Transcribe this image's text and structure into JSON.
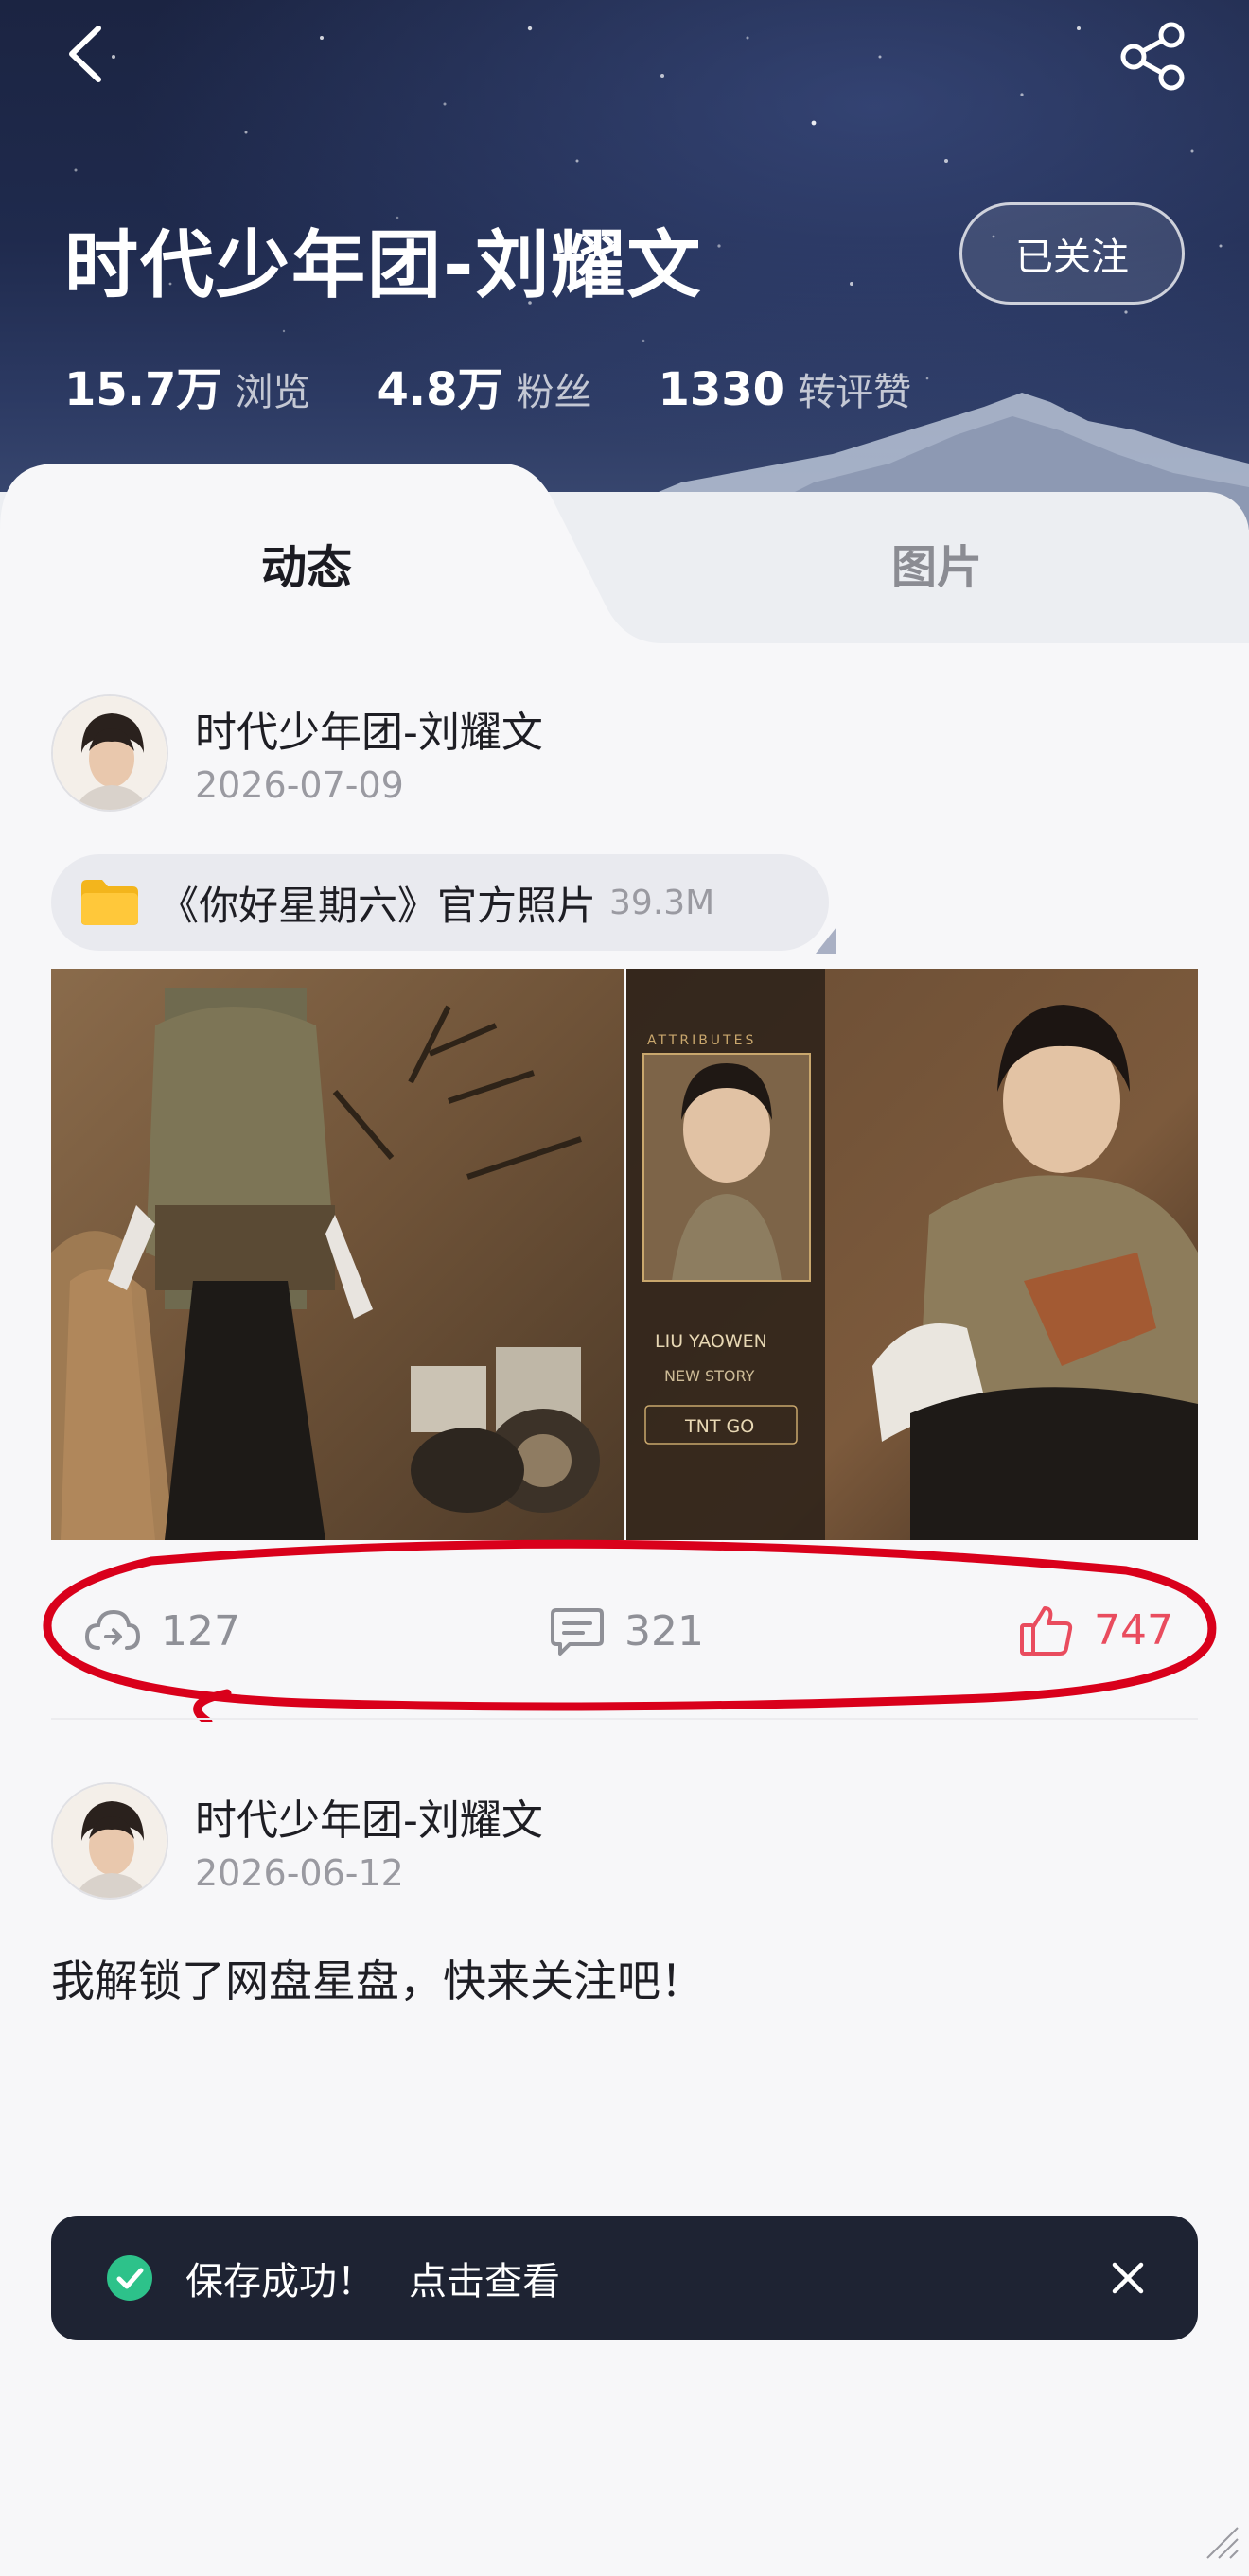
{
  "header": {
    "title": "时代少年团-刘耀文",
    "follow_label": "已关注",
    "stats": [
      {
        "value": "15.7万",
        "label": "浏览"
      },
      {
        "value": "4.8万",
        "label": "粉丝"
      },
      {
        "value": "1330",
        "label": "转评赞"
      }
    ]
  },
  "tabs": [
    {
      "label": "动态",
      "active": true
    },
    {
      "label": "图片",
      "active": false
    }
  ],
  "posts": [
    {
      "author": "时代少年团-刘耀文",
      "date": "2026-07-09",
      "file": {
        "name": "《你好星期六》官方照片",
        "size": "39.3M",
        "icon": "folder-icon"
      },
      "photo_overlay": {
        "attributes": "ATTRIBUTES",
        "name": "LIU YAOWEN",
        "story": "NEW STORY",
        "badge": "TNT GO"
      },
      "actions": {
        "shares": "127",
        "comments": "321",
        "likes": "747"
      }
    },
    {
      "author": "时代少年团-刘耀文",
      "date": "2026-06-12",
      "text": "我解锁了网盘星盘，快来关注吧！"
    }
  ],
  "toast": {
    "message": "保存成功！",
    "action_label": "点击查看"
  },
  "colors": {
    "like_red": "#e94c5e",
    "toast_bg": "#1e2333",
    "check_green": "#2dc28a",
    "highlight_ring": "#d9001b"
  }
}
